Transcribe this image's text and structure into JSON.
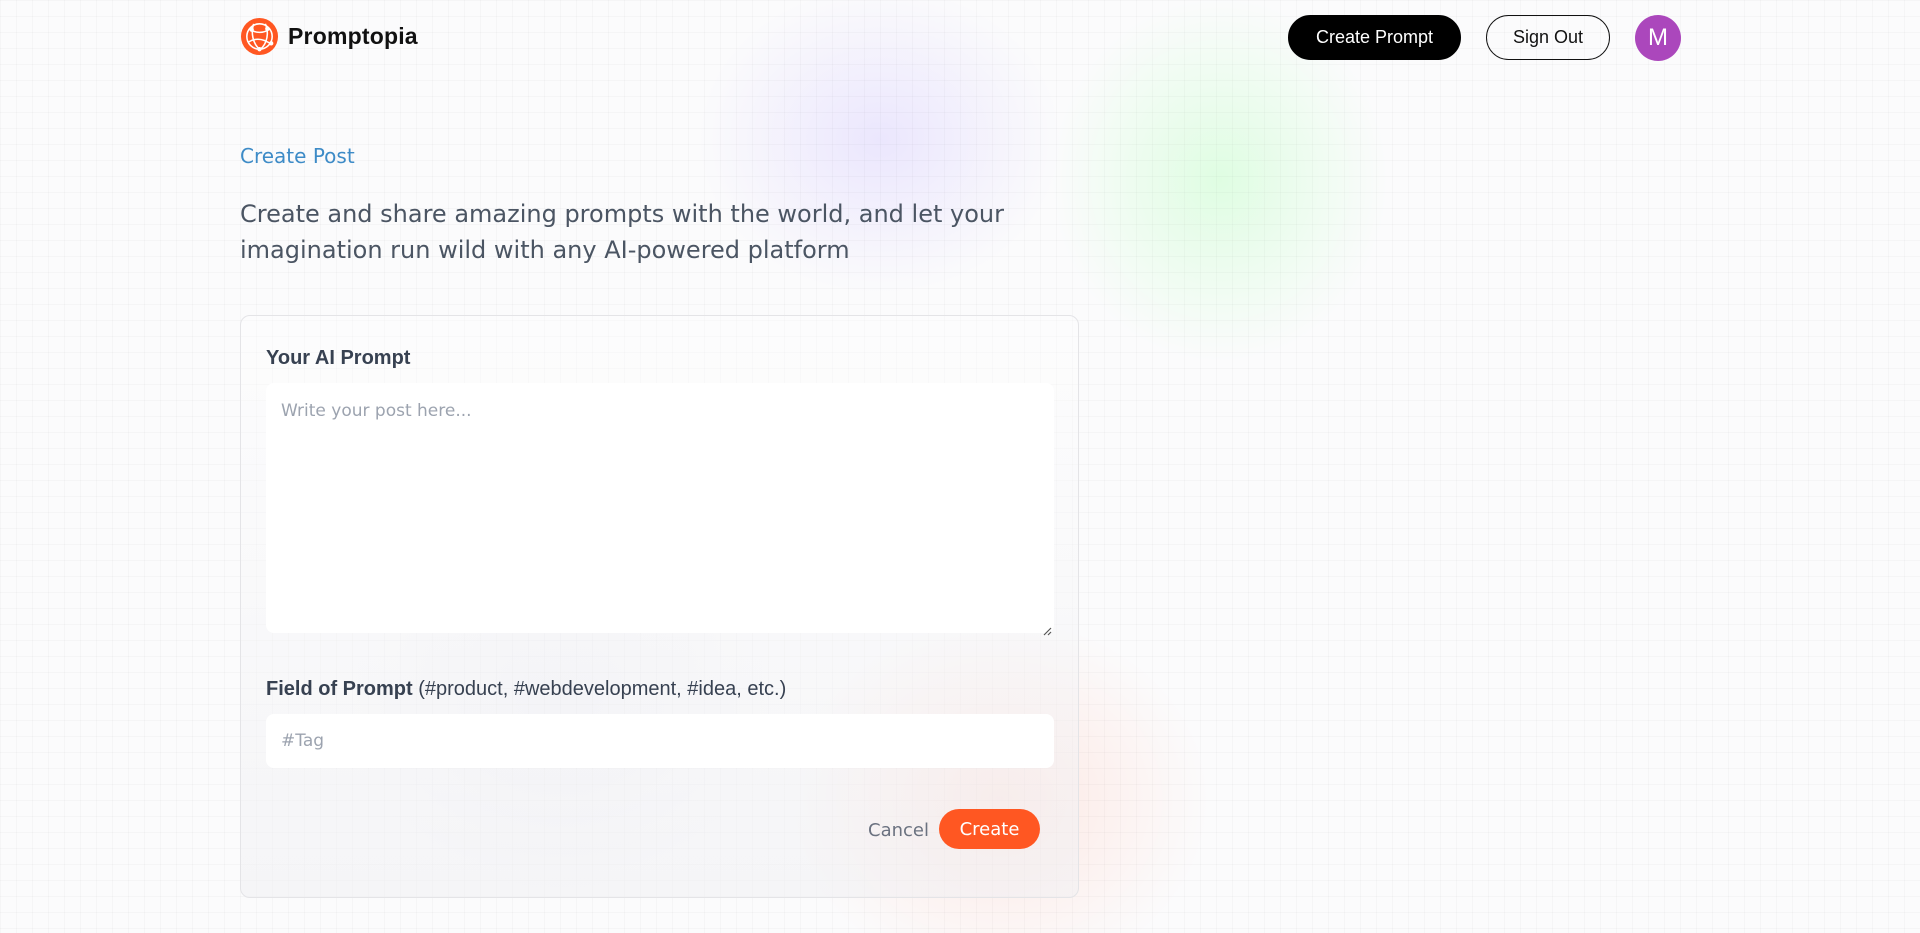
{
  "nav": {
    "brand": "Promptopia",
    "create_prompt_label": "Create Prompt",
    "sign_out_label": "Sign Out",
    "avatar_initial": "M"
  },
  "header": {
    "title": "Create Post",
    "description": "Create and share amazing prompts with the world, and let your imagination run wild with any AI-powered platform"
  },
  "form": {
    "prompt_label": "Your AI Prompt",
    "prompt_placeholder": "Write your post here...",
    "prompt_value": "",
    "tag_label_bold": "Field of Prompt",
    "tag_label_hint": " (#product, #webdevelopment, #idea, etc.)",
    "tag_placeholder": "#Tag",
    "tag_value": "",
    "cancel_label": "Cancel",
    "submit_label": "Create"
  },
  "colors": {
    "accent": "#ff5722",
    "link": "#3d8bc7",
    "avatar": "#ab47bc",
    "primary_button": "#000000"
  },
  "icons": {
    "logo": "globe-network-icon",
    "resize": "resize-handle-icon"
  }
}
